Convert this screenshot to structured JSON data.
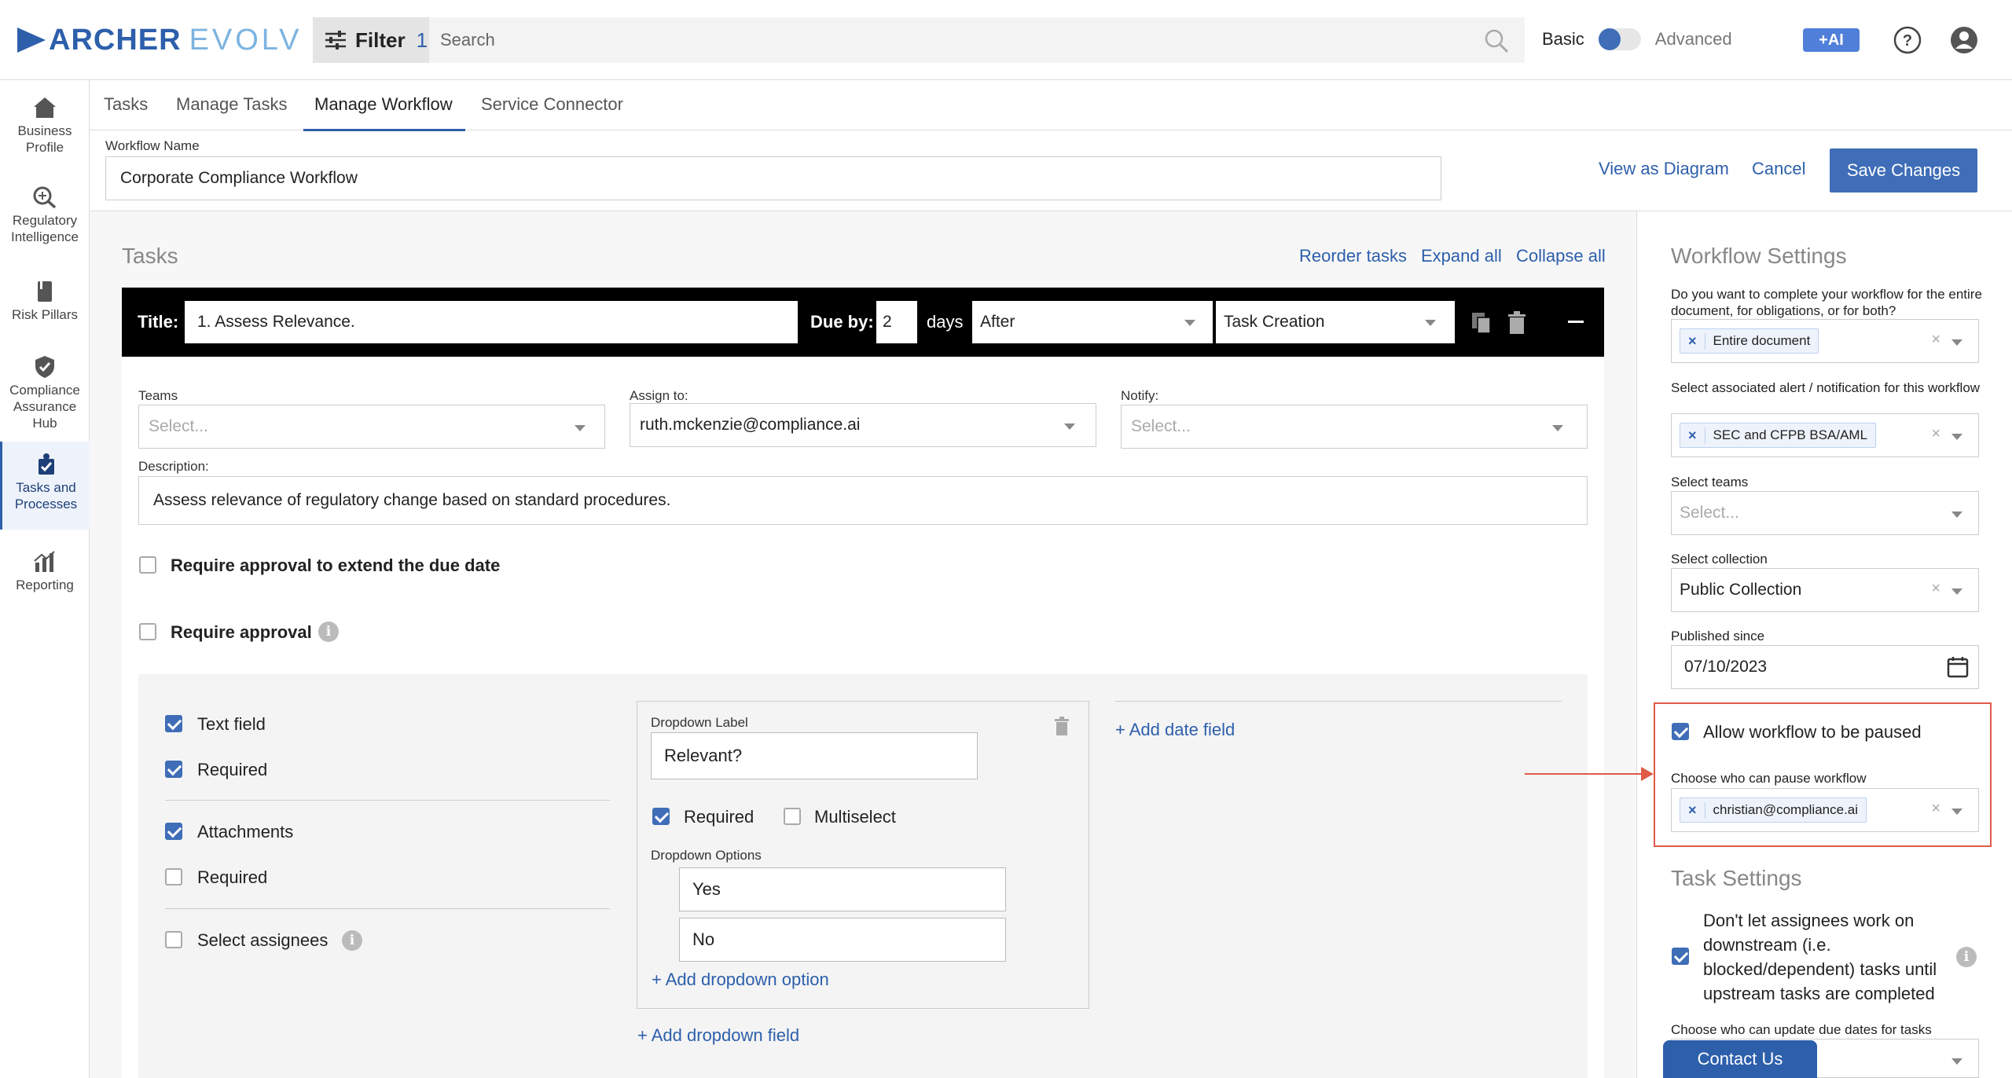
{
  "header": {
    "logo_primary": "ARCHER",
    "logo_secondary": "EVOLV",
    "filter_label": "Filter",
    "filter_count": "1",
    "search_placeholder": "Search",
    "mode_basic": "Basic",
    "mode_advanced": "Advanced",
    "ai_label": "+AI",
    "advanced_mode_on": false
  },
  "sidebar": {
    "items": [
      {
        "label": "Business Profile",
        "icon": "home-icon"
      },
      {
        "label": "Regulatory Intelligence",
        "icon": "magnifier-icon"
      },
      {
        "label": "Risk Pillars",
        "icon": "book-icon"
      },
      {
        "label": "Compliance Assurance Hub",
        "icon": "shield-check-icon"
      },
      {
        "label": "Tasks and Processes",
        "icon": "tasks-icon",
        "active": true
      },
      {
        "label": "Reporting",
        "icon": "chart-icon"
      }
    ]
  },
  "tabs": [
    "Tasks",
    "Manage Tasks",
    "Manage Workflow",
    "Service Connector"
  ],
  "workflow": {
    "name_label": "Workflow Name",
    "name_value": "Corporate Compliance Workflow",
    "view_diagram": "View as Diagram",
    "cancel": "Cancel",
    "save": "Save Changes"
  },
  "tasks": {
    "heading": "Tasks",
    "reorder": "Reorder tasks",
    "expand_all": "Expand all",
    "collapse_all": "Collapse all",
    "task": {
      "title_label": "Title:",
      "title_value": "1. Assess Relevance.",
      "due_by_label": "Due by:",
      "due_by_value": "2",
      "days_label": "days",
      "relation": "After",
      "anchor": "Task Creation",
      "teams_label": "Teams",
      "teams_placeholder": "Select...",
      "assign_label": "Assign to:",
      "assign_value": "ruth.mckenzie@compliance.ai",
      "notify_label": "Notify:",
      "notify_placeholder": "Select...",
      "description_label": "Description:",
      "description_value": "Assess relevance of regulatory change based on standard procedures.",
      "require_extend": "Require approval to extend the due date",
      "require_approval": "Require approval",
      "text_field": "Text field",
      "required": "Required",
      "attachments": "Attachments",
      "select_assignees": "Select assignees",
      "dropdown_label_caption": "Dropdown Label",
      "dropdown_label_value": "Relevant?",
      "multiselect": "Multiselect",
      "dropdown_options_caption": "Dropdown Options",
      "option_yes": "Yes",
      "option_no": "No",
      "add_option": "+ Add dropdown option",
      "add_dropdown": "+ Add dropdown field",
      "add_date": "+ Add date field"
    }
  },
  "settings": {
    "heading": "Workflow Settings",
    "q_scope": "Do you want to complete your workflow for the entire document, for obligations, or for both?",
    "scope_tag": "Entire document",
    "q_alert": "Select associated alert / notification for this workflow",
    "alert_tag": "SEC and CFPB BSA/AML",
    "teams_label": "Select teams",
    "teams_placeholder": "Select...",
    "collection_label": "Select collection",
    "collection_value": "Public Collection",
    "published_label": "Published since",
    "published_value": "07/10/2023",
    "allow_pause": "Allow workflow to be paused",
    "pause_who_label": "Choose who can pause workflow",
    "pause_who_tag": "christian@compliance.ai",
    "task_settings_heading": "Task Settings",
    "downstream_text": "Don't let assignees work on downstream (i.e. blocked/dependent) tasks until upstream tasks are completed",
    "due_dates_label": "Choose who can update due dates for tasks",
    "contact_us": "Contact Us"
  },
  "colors": {
    "accent": "#3f6db7",
    "highlight": "#e05a47",
    "task_bar": "#000000"
  }
}
